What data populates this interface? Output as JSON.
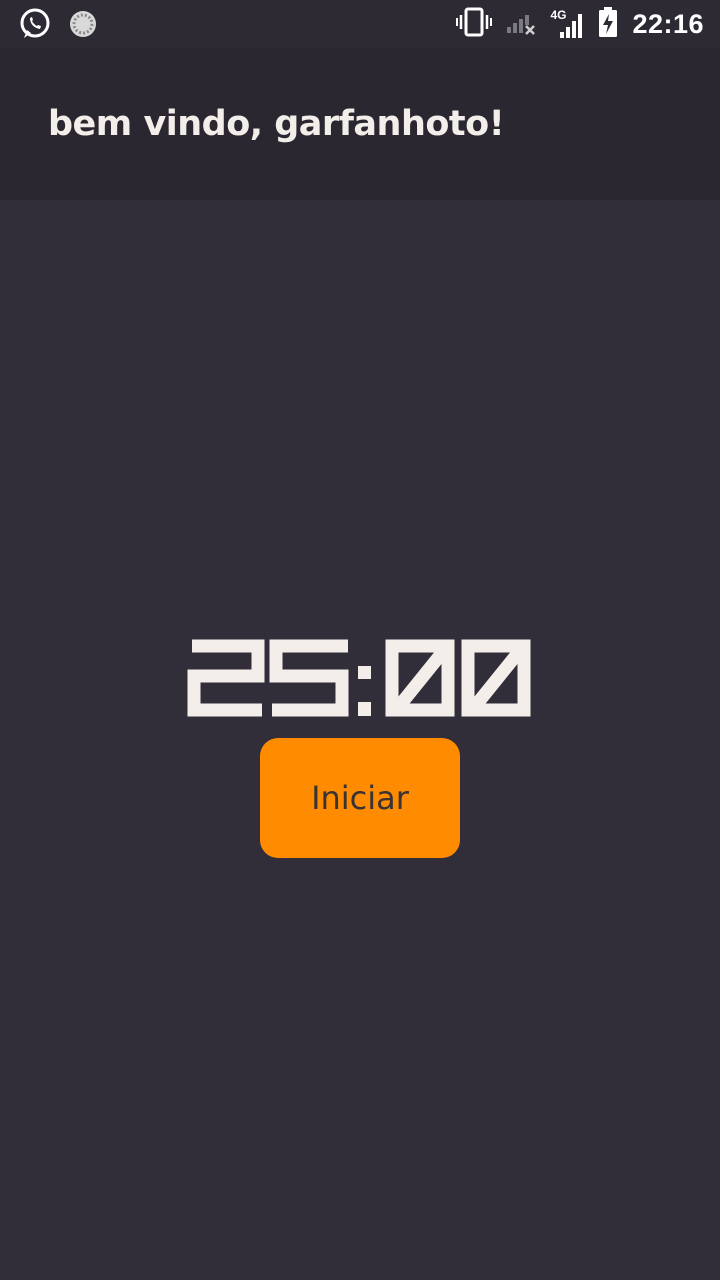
{
  "status_bar": {
    "time": "22:16",
    "network_label": "4G",
    "icons": [
      "whatsapp-icon",
      "sync-icon",
      "vibrate-icon",
      "signal-no-service-icon",
      "signal-4g-icon",
      "battery-charging-icon"
    ]
  },
  "app_bar": {
    "title": "bem vindo, garfanhoto!"
  },
  "timer": {
    "display": "25:00"
  },
  "controls": {
    "start_label": "Iniciar"
  },
  "colors": {
    "background": "#312d39",
    "app_bar": "#2a2731",
    "status_bar": "#2d2a34",
    "accent": "#ff8c00",
    "text": "#f3eee9"
  }
}
